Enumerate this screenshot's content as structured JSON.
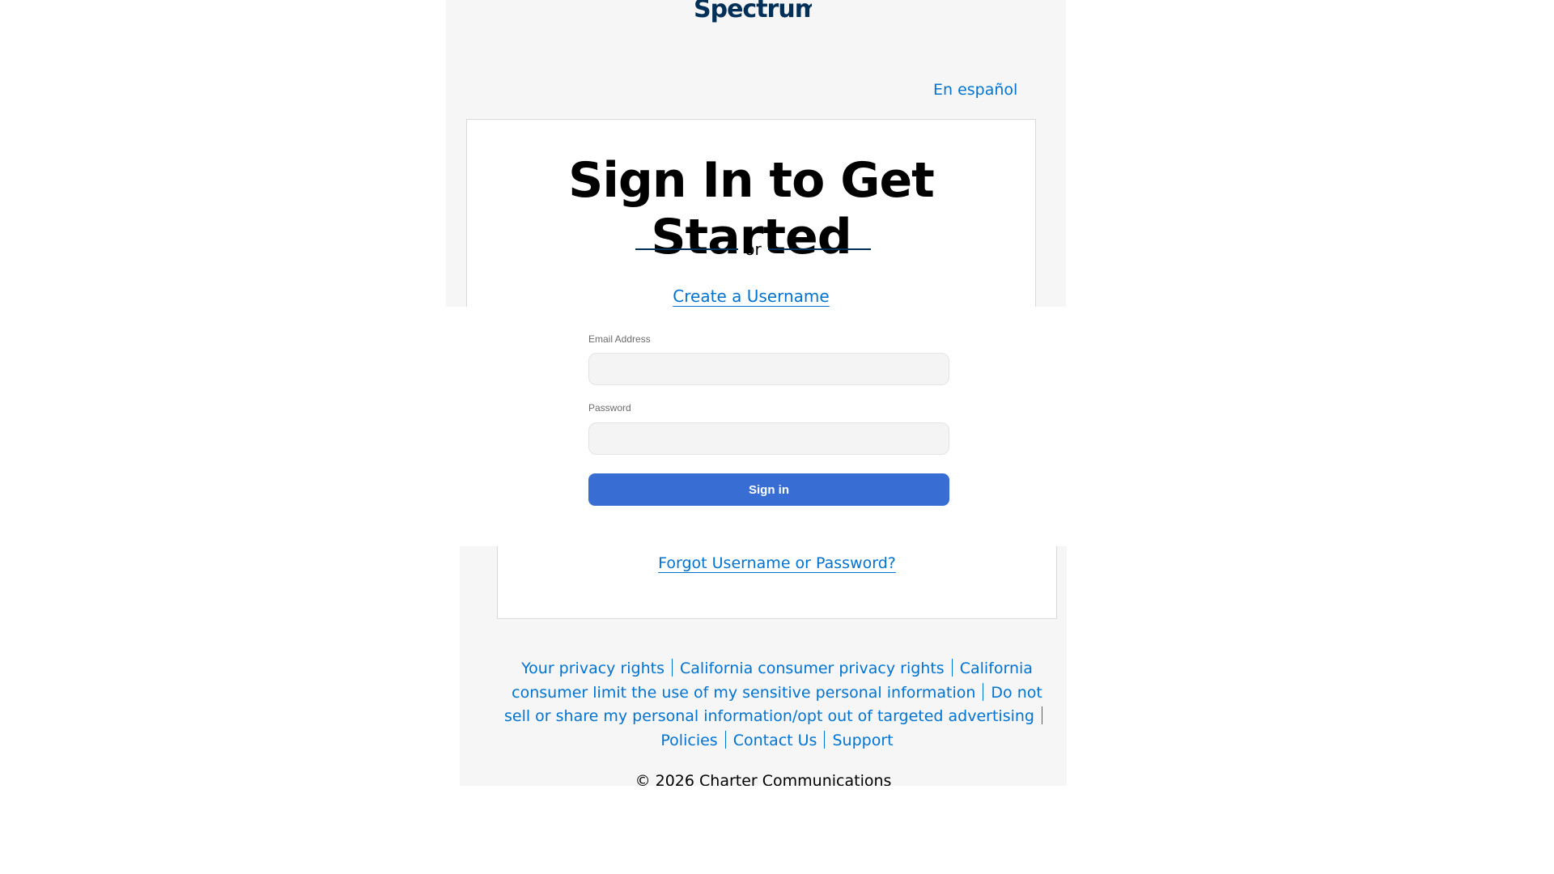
{
  "header": {
    "logo_text": "Spectrum",
    "language_link": "En español"
  },
  "card": {
    "headline": "Sign In to Get Started",
    "divider_text": "or",
    "create_username_link": "Create a Username",
    "forgot_link": "Forgot Username or Password?"
  },
  "form": {
    "email_label": "Email Address",
    "email_value": "",
    "password_label": "Password",
    "password_value": "",
    "signin_button": "Sign in"
  },
  "footer": {
    "links": {
      "privacy_rights": "Your privacy rights",
      "ca_privacy_rights": "California consumer privacy rights",
      "ca_limit_use": "California consumer limit the use of my sensitive personal information",
      "do_not_sell": "Do not sell or share my personal information/opt out of targeted advertising",
      "policies": "Policies",
      "contact_us": "Contact Us",
      "support": "Support"
    },
    "copyright": "© 2026 Charter Communications"
  },
  "colors": {
    "link_blue": "#0073d1",
    "button_blue": "#386ed4",
    "brand_navy": "#003057",
    "panel_grey": "#f6f6f6"
  }
}
